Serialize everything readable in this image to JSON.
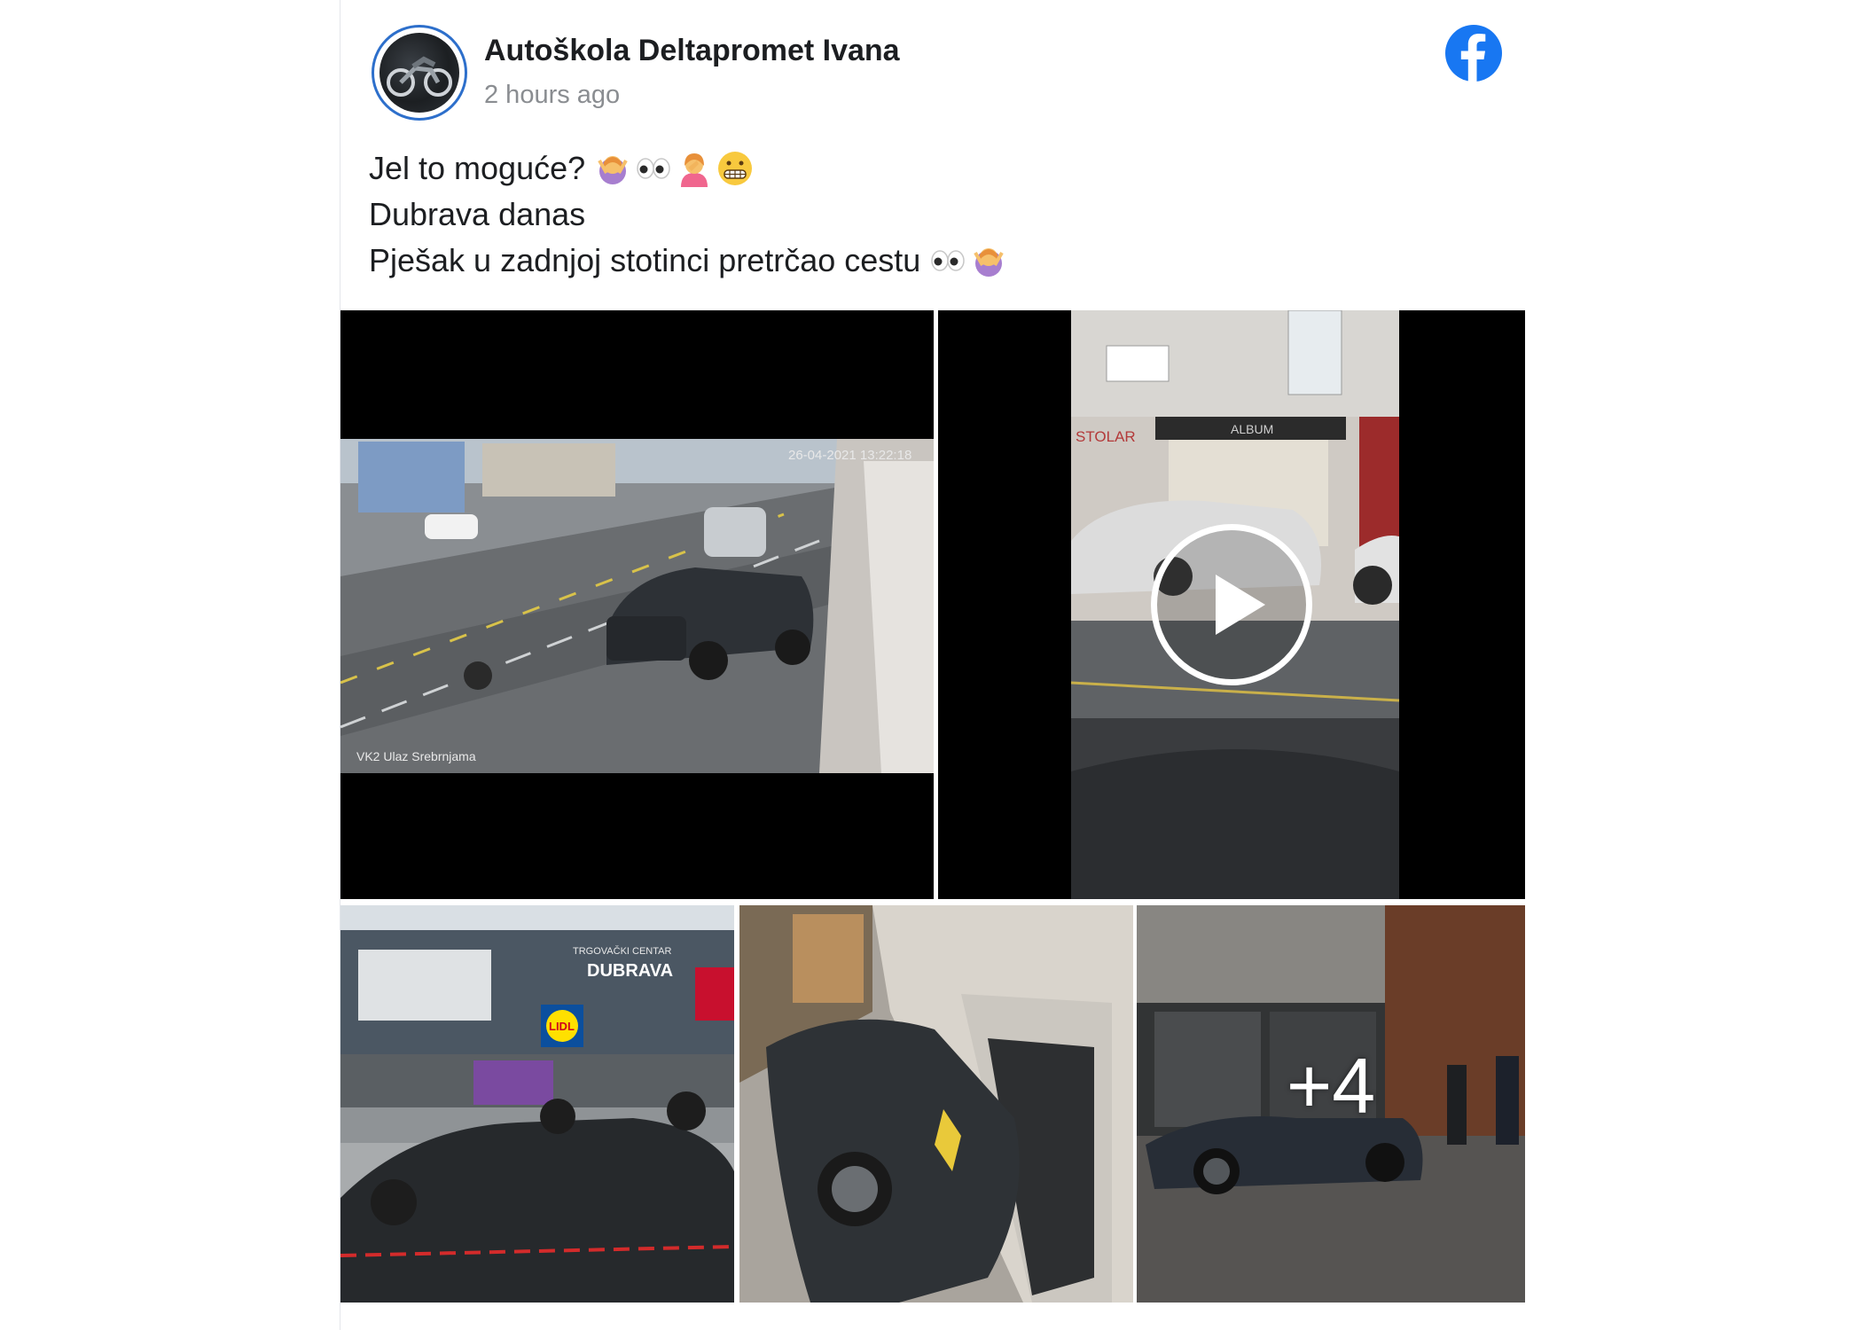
{
  "post": {
    "author": "Autoškola Deltapromet Ivana",
    "timestamp": "2 hours ago",
    "lines": [
      {
        "text": "Jel to moguće?",
        "emojis": [
          "woman-gesturing-ok-emoji",
          "eyes-emoji",
          "woman-facepalming-emoji",
          "grimacing-face-emoji"
        ]
      },
      {
        "text": "Dubrava danas",
        "emojis": []
      },
      {
        "text": "Pješak u zadnjoj stotinci pretrčao cestu",
        "emojis": [
          "eyes-emoji",
          "woman-gesturing-ok-emoji"
        ]
      }
    ],
    "more_photos_label": "+4",
    "cctv_timestamp": "26-04-2021 13:22:18",
    "cctv_camera": "VK2 Ulaz Srebrnjama",
    "mall_sign_small": "TRGOVAČKI CENTAR",
    "mall_sign_big": "DUBRAVA",
    "lidl_label": "LIDL",
    "shop_sign": "STOLAR",
    "store_sign": "ALBUM"
  },
  "icons": {
    "brand": "facebook-logo",
    "play": "play-icon"
  },
  "colors": {
    "facebook_blue": "#1877f2",
    "avatar_ring": "#2d6fcb",
    "timestamp_gray": "#8a8d91"
  }
}
